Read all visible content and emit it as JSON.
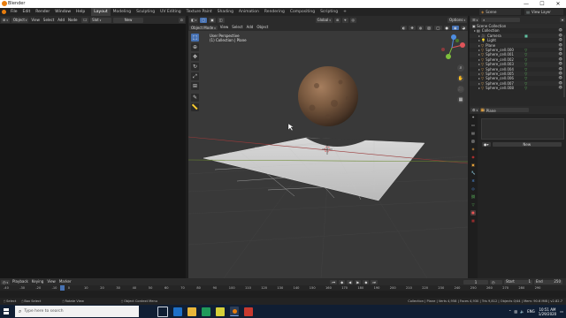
{
  "window": {
    "title": "Blender",
    "minimize": "—",
    "maximize": "☐",
    "close": "✕"
  },
  "menubar": {
    "menus": [
      "File",
      "Edit",
      "Render",
      "Window",
      "Help"
    ],
    "workspaces": [
      "Layout",
      "Modeling",
      "Sculpting",
      "UV Editing",
      "Texture Paint",
      "Shading",
      "Animation",
      "Rendering",
      "Compositing",
      "Scripting"
    ],
    "active_workspace": "Layout",
    "add_tab": "+",
    "scene": "Scene",
    "view_layer": "View Layer"
  },
  "node_editor": {
    "editor_type": "Object",
    "menus": [
      "View",
      "Select",
      "Add",
      "Node"
    ],
    "slot": "Slot",
    "new_button": "New"
  },
  "viewport_header": {
    "transform": "Global",
    "options": "Options"
  },
  "viewport_subheader": {
    "mode": "Object Mode",
    "menus": [
      "View",
      "Select",
      "Add",
      "Object"
    ]
  },
  "viewport_overlay": {
    "perspective": "User Perspective",
    "collection": "(1) Collection | Plane"
  },
  "outliner": {
    "title": "Scene Collection",
    "items": [
      {
        "label": "Collection",
        "icon": "collection-icon",
        "indent": 1
      },
      {
        "label": "Camera",
        "icon": "camera-icon",
        "indent": 2
      },
      {
        "label": "Light",
        "icon": "light-icon",
        "indent": 2
      },
      {
        "label": "Plane",
        "icon": "mesh-icon",
        "indent": 2
      },
      {
        "label": "Sphere_cell.000",
        "icon": "mesh-icon",
        "indent": 2
      },
      {
        "label": "Sphere_cell.001",
        "icon": "mesh-icon",
        "indent": 2
      },
      {
        "label": "Sphere_cell.002",
        "icon": "mesh-icon",
        "indent": 2
      },
      {
        "label": "Sphere_cell.003",
        "icon": "mesh-icon",
        "indent": 2
      },
      {
        "label": "Sphere_cell.004",
        "icon": "mesh-icon",
        "indent": 2
      },
      {
        "label": "Sphere_cell.005",
        "icon": "mesh-icon",
        "indent": 2
      },
      {
        "label": "Sphere_cell.006",
        "icon": "mesh-icon",
        "indent": 2
      },
      {
        "label": "Sphere_cell.007",
        "icon": "mesh-icon",
        "indent": 2
      },
      {
        "label": "Sphere_cell.008",
        "icon": "mesh-icon",
        "indent": 2
      }
    ]
  },
  "properties": {
    "object_name": "Plane",
    "new_button": "New"
  },
  "timeline": {
    "menus": [
      "Playback",
      "Keying",
      "View",
      "Marker"
    ],
    "current_frame": "1",
    "start_label": "Start",
    "start": "1",
    "end_label": "End",
    "end": "250",
    "ruler": [
      "-40",
      "-30",
      "-20",
      "-10",
      "0",
      "10",
      "20",
      "30",
      "40",
      "50",
      "60",
      "70",
      "80",
      "90",
      "100",
      "110",
      "120",
      "130",
      "140",
      "150",
      "160",
      "170",
      "180",
      "190",
      "200",
      "210",
      "220",
      "230",
      "240",
      "250",
      "260",
      "270",
      "280",
      "290"
    ]
  },
  "statusbar": {
    "left": [
      "Select",
      "Box Select",
      "Rotate View",
      "Object Context Menu"
    ],
    "right": "Collection | Plane | Verts 4,958 | Faces 4,930 | Tris 9,812 | Objects 0/44 | Mem: 90.6 MiB | v2.82.7"
  },
  "taskbar": {
    "search_placeholder": "Type here to search",
    "time": "10:51 AM",
    "date": "1/29/2020"
  },
  "colors": {
    "accent": "#4772b3",
    "blender_orange": "#e87d0d",
    "viewport_bg": "#393939",
    "taskbar": "#101e33"
  }
}
